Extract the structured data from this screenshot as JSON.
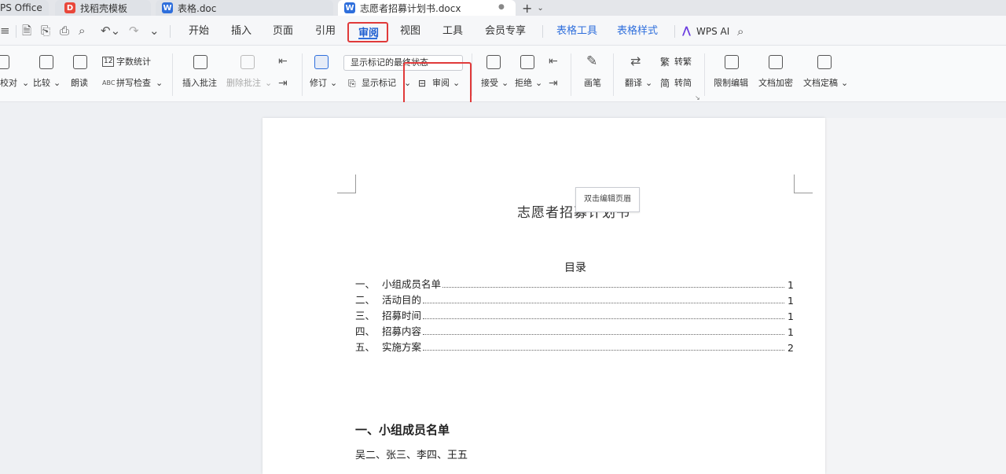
{
  "tabs": {
    "wps": "PS Office",
    "templates": "找稻壳模板",
    "biaoge": "表格.doc",
    "active": "志愿者招募计划书.docx"
  },
  "menu": {
    "items": [
      "开始",
      "插入",
      "页面",
      "引用",
      "审阅",
      "视图",
      "工具",
      "会员专享",
      "表格工具",
      "表格样式",
      "WPS AI"
    ]
  },
  "ribbon": {
    "proofread": "校对",
    "compare": "比较",
    "read_aloud": "朗读",
    "word_count": "字数统计",
    "spell_check": "拼写检查",
    "insert_comment": "插入批注",
    "delete_comment": "删除批注",
    "revise": "修订",
    "show_state": "显示标记的最终状态",
    "show_marks": "显示标记",
    "review": "审阅",
    "accept": "接受",
    "reject": "拒绝",
    "pen": "画笔",
    "translate": "翻译",
    "to_traditional": "转繁",
    "to_simplified": "转简",
    "restrict_edit": "限制编辑",
    "encrypt": "文档加密",
    "finalize": "文档定稿"
  },
  "document": {
    "header_tip": "双击编辑页眉",
    "title": "志愿者招募计划书",
    "toc_title": "目录",
    "toc": [
      {
        "num": "一、",
        "text": "小组成员名单",
        "page": "1"
      },
      {
        "num": "二、",
        "text": "活动目的",
        "page": "1"
      },
      {
        "num": "三、",
        "text": "招募时间",
        "page": "1"
      },
      {
        "num": "四、",
        "text": "招募内容",
        "page": "1"
      },
      {
        "num": "五、",
        "text": "实施方案",
        "page": "2"
      }
    ],
    "section1_title": "一、小组成员名单",
    "section1_body": "吴二、张三、李四、王五"
  },
  "colors": {
    "accent": "#2f6fdc",
    "highlight": "#e03a3a"
  }
}
